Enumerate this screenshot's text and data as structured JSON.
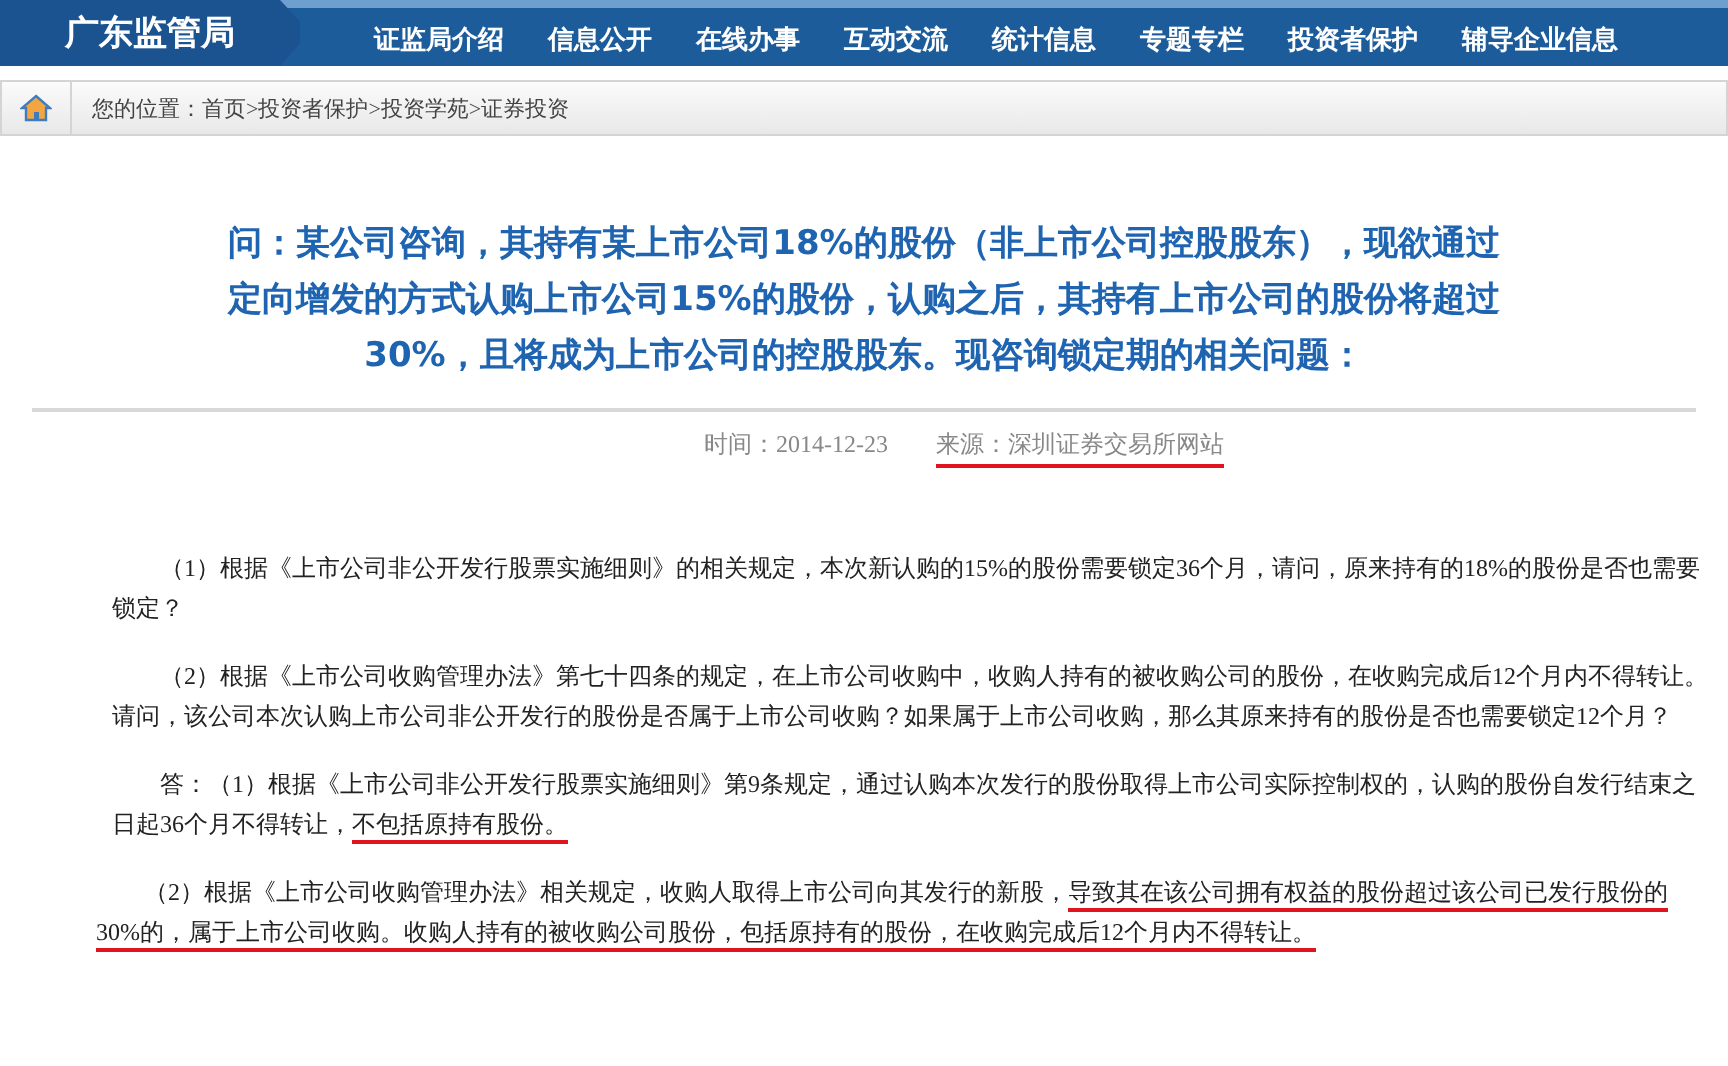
{
  "header": {
    "logo": "广东监管局",
    "nav": [
      "证监局介绍",
      "信息公开",
      "在线办事",
      "互动交流",
      "统计信息",
      "专题专栏",
      "投资者保护",
      "辅导企业信息"
    ]
  },
  "breadcrumb": "您的位置：首页>投资者保护>投资学苑>证券投资",
  "article": {
    "title": "问：某公司咨询，其持有某上市公司18%的股份（非上市公司控股股东），现欲通过定向增发的方式认购上市公司15%的股份，认购之后，其持有上市公司的股份将超过30%，且将成为上市公司的控股股东。现咨询锁定期的相关问题：",
    "time": "时间：2014-12-23",
    "source": {
      "text": "来源：深圳证券交易所网站",
      "underlined": true
    },
    "paragraphs": [
      [
        {
          "text": "（1）根据《上市公司非公开发行股票实施细则》的相关规定，本次新认购的15%的股份需要锁定36个月，请问，原来持有的18%的股份是否也需要锁定？",
          "underlined": false
        }
      ],
      [
        {
          "text": "（2）根据《上市公司收购管理办法》第七十四条的规定，在上市公司收购中，收购人持有的被收购公司的股份，在收购完成后12个月内不得转让。请问，该公司本次认购上市公司非公开发行的股份是否属于上市公司收购？如果属于上市公司收购，那么其原来持有的股份是否也需要锁定12个月？",
          "underlined": false
        }
      ],
      [
        {
          "text": "答：（1）根据《上市公司非公开发行股票实施细则》第9条规定，通过认购本次发行的股份取得上市公司实际控制权的，认购的股份自发行结束之日起36个月不得转让，",
          "underlined": false
        },
        {
          "text": "不包括原持有股份。",
          "underlined": true
        }
      ],
      [
        {
          "text": "（2）根据《上市公司收购管理办法》相关规定，收购人取得上市公司向其发行的新股，",
          "underlined": false
        },
        {
          "text": "导致其在该公司拥有权益的股份超过该公司已发行股份的30%的，属于上市公司收购。收购人持有的被收购公司股份，包括原持有的股份，在收购完成后12个月内不得转让。",
          "underlined": true
        }
      ]
    ]
  }
}
